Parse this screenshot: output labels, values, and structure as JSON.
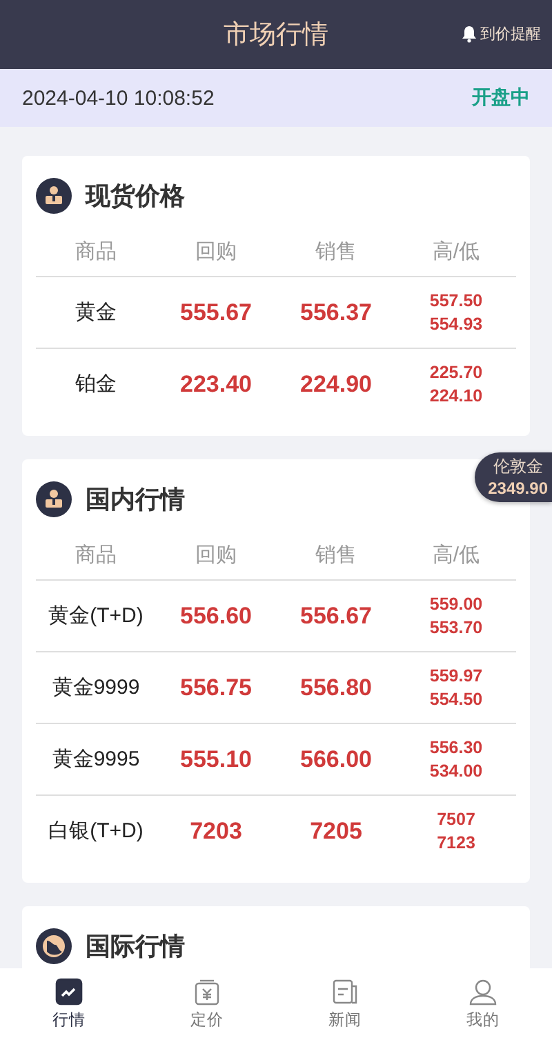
{
  "header": {
    "title": "市场行情",
    "alert_link": "到价提醒"
  },
  "status_bar": {
    "time": "2024-04-10 10:08:52",
    "market_state": "开盘中"
  },
  "floating_quote": {
    "label": "伦敦金",
    "value": "2349.90"
  },
  "sections": [
    {
      "title": "现货价格",
      "columns": [
        "商品",
        "回购",
        "销售",
        "高/低"
      ],
      "rows": [
        {
          "name": "黄金",
          "buy": "555.67",
          "sell": "556.37",
          "high": "557.50",
          "low": "554.93"
        },
        {
          "name": "铂金",
          "buy": "223.40",
          "sell": "224.90",
          "high": "225.70",
          "low": "224.10"
        }
      ]
    },
    {
      "title": "国内行情",
      "columns": [
        "商品",
        "回购",
        "销售",
        "高/低"
      ],
      "rows": [
        {
          "name": "黄金(T+D)",
          "buy": "556.60",
          "sell": "556.67",
          "high": "559.00",
          "low": "553.70"
        },
        {
          "name": "黄金9999",
          "buy": "556.75",
          "sell": "556.80",
          "high": "559.97",
          "low": "554.50"
        },
        {
          "name": "黄金9995",
          "buy": "555.10",
          "sell": "566.00",
          "high": "556.30",
          "low": "534.00"
        },
        {
          "name": "白银(T+D)",
          "buy": "7203",
          "sell": "7205",
          "high": "7507",
          "low": "7123"
        }
      ]
    },
    {
      "title": "国际行情"
    }
  ],
  "tabs": [
    {
      "label": "行情",
      "kind": "chart",
      "selected": true
    },
    {
      "label": "定价",
      "kind": "price",
      "selected": false
    },
    {
      "label": "新闻",
      "kind": "news",
      "selected": false
    },
    {
      "label": "我的",
      "kind": "user",
      "selected": false
    }
  ]
}
